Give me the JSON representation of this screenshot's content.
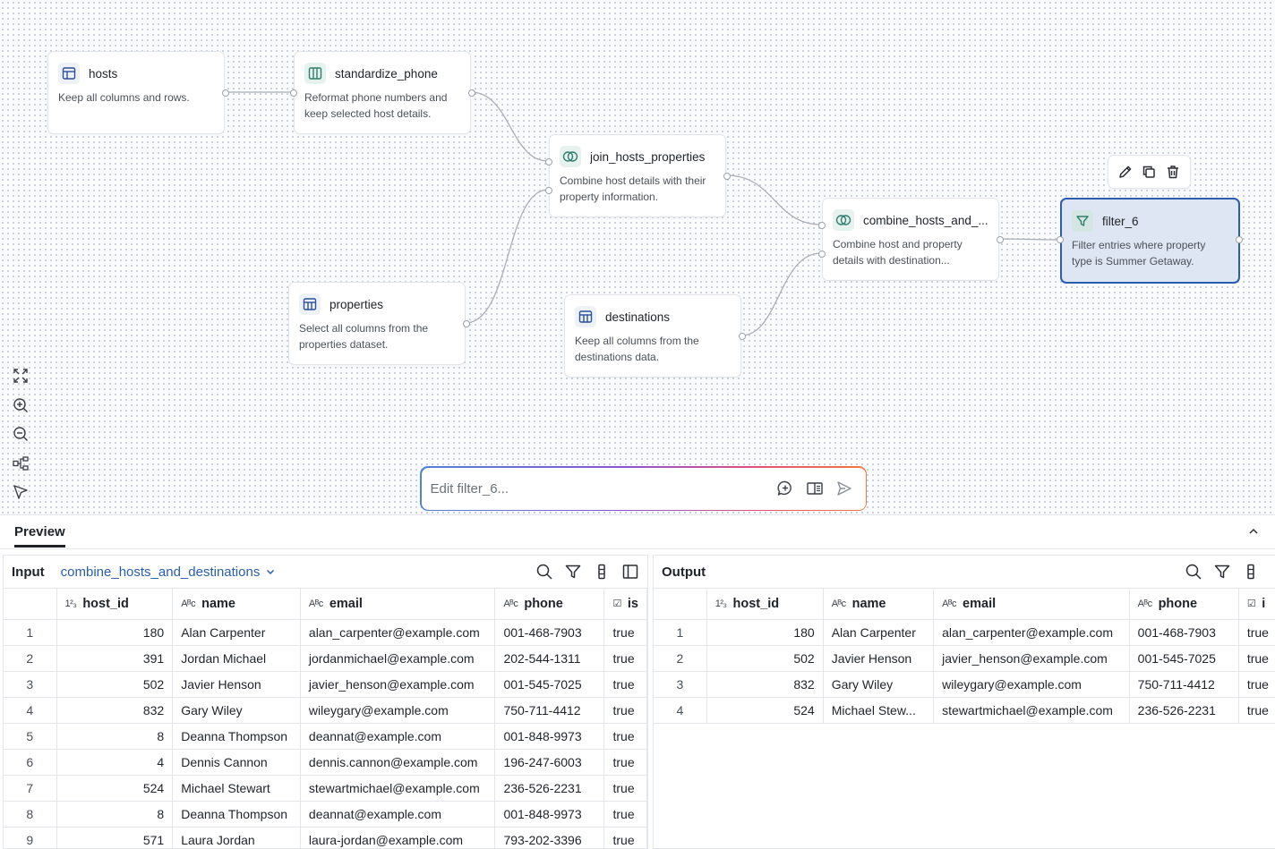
{
  "nodes": {
    "hosts": {
      "title": "hosts",
      "desc": "Keep all columns and rows.",
      "icon": "table-icon"
    },
    "standardize_phone": {
      "title": "standardize_phone",
      "desc": "Reformat phone numbers and keep selected host details.",
      "icon": "columns-icon"
    },
    "join_hosts_properties": {
      "title": "join_hosts_properties",
      "desc": "Combine host details with their property information.",
      "icon": "join-icon"
    },
    "properties": {
      "title": "properties",
      "desc": "Select all columns from the properties dataset.",
      "icon": "table-icon"
    },
    "destinations": {
      "title": "destinations",
      "desc": "Keep all columns from the destinations data.",
      "icon": "table-icon"
    },
    "combine": {
      "title": "combine_hosts_and_...",
      "desc": "Combine host and property details with destination...",
      "icon": "join-icon"
    },
    "filter_6": {
      "title": "filter_6",
      "desc": "Filter entries where property type is Summer Getaway.",
      "icon": "filter-icon"
    }
  },
  "edit": {
    "placeholder": "Edit filter_6..."
  },
  "preview": {
    "tab_label": "Preview"
  },
  "input_panel": {
    "label": "Input",
    "dataset": "combine_hosts_and_destinations",
    "columns": [
      {
        "type": "1²₃",
        "name": "host_id"
      },
      {
        "type": "Aᴮc",
        "name": "name"
      },
      {
        "type": "Aᴮc",
        "name": "email"
      },
      {
        "type": "Aᴮc",
        "name": "phone"
      },
      {
        "type": "☑",
        "name": "is"
      }
    ],
    "rows": [
      {
        "idx": "1",
        "host_id": "180",
        "name": "Alan Carpenter",
        "email": "alan_carpenter@example.com",
        "phone": "001-468-7903",
        "flag": "true"
      },
      {
        "idx": "2",
        "host_id": "391",
        "name": "Jordan Michael",
        "email": "jordanmichael@example.com",
        "phone": "202-544-1311",
        "flag": "true"
      },
      {
        "idx": "3",
        "host_id": "502",
        "name": "Javier Henson",
        "email": "javier_henson@example.com",
        "phone": "001-545-7025",
        "flag": "true"
      },
      {
        "idx": "4",
        "host_id": "832",
        "name": "Gary Wiley",
        "email": "wileygary@example.com",
        "phone": "750-711-4412",
        "flag": "true"
      },
      {
        "idx": "5",
        "host_id": "8",
        "name": "Deanna Thompson",
        "email": "deannat@example.com",
        "phone": "001-848-9973",
        "flag": "true"
      },
      {
        "idx": "6",
        "host_id": "4",
        "name": "Dennis Cannon",
        "email": "dennis.cannon@example.com",
        "phone": "196-247-6003",
        "flag": "true"
      },
      {
        "idx": "7",
        "host_id": "524",
        "name": "Michael Stewart",
        "email": "stewartmichael@example.com",
        "phone": "236-526-2231",
        "flag": "true"
      },
      {
        "idx": "8",
        "host_id": "8",
        "name": "Deanna Thompson",
        "email": "deannat@example.com",
        "phone": "001-848-9973",
        "flag": "true"
      },
      {
        "idx": "9",
        "host_id": "571",
        "name": "Laura Jordan",
        "email": "laura-jordan@example.com",
        "phone": "793-202-3396",
        "flag": "true"
      }
    ]
  },
  "output_panel": {
    "label": "Output",
    "columns": [
      {
        "type": "1²₃",
        "name": "host_id"
      },
      {
        "type": "Aᴮc",
        "name": "name"
      },
      {
        "type": "Aᴮc",
        "name": "email"
      },
      {
        "type": "Aᴮc",
        "name": "phone"
      },
      {
        "type": "☑",
        "name": "i"
      }
    ],
    "rows": [
      {
        "idx": "1",
        "host_id": "180",
        "name": "Alan Carpenter",
        "email": "alan_carpenter@example.com",
        "phone": "001-468-7903",
        "flag": "true"
      },
      {
        "idx": "2",
        "host_id": "502",
        "name": "Javier Henson",
        "email": "javier_henson@example.com",
        "phone": "001-545-7025",
        "flag": "true"
      },
      {
        "idx": "3",
        "host_id": "832",
        "name": "Gary Wiley",
        "email": "wileygary@example.com",
        "phone": "750-711-4412",
        "flag": "true"
      },
      {
        "idx": "4",
        "host_id": "524",
        "name": "Michael Stew...",
        "email": "stewartmichael@example.com",
        "phone": "236-526-2231",
        "flag": "true"
      }
    ]
  },
  "colors": {
    "accent": "#2a5db0",
    "selected_bg": "#dde6f2",
    "teal_icon": "#2f7f6f"
  }
}
